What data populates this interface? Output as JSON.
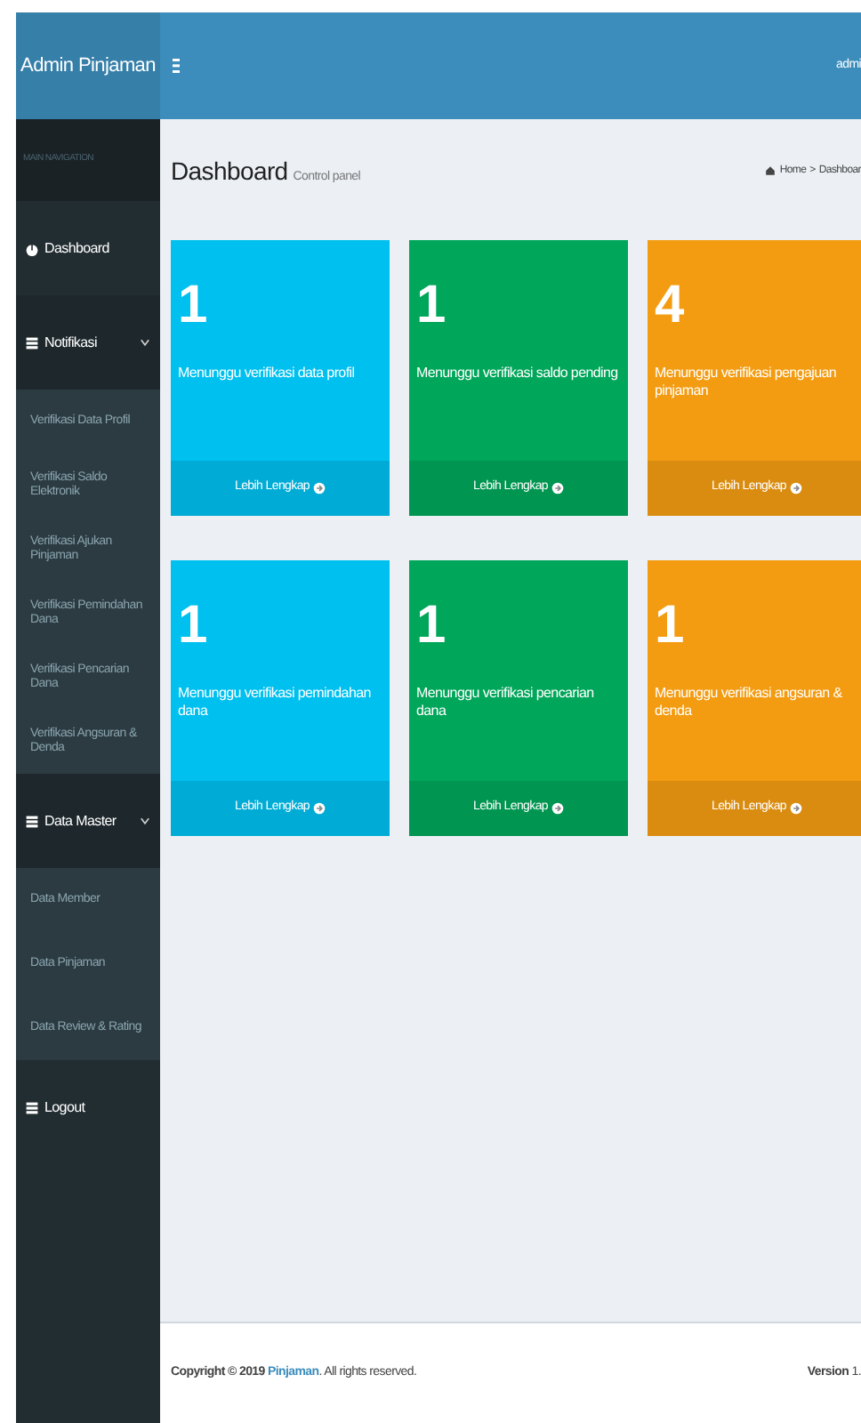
{
  "brand": "Admin Pinjaman",
  "header": {
    "user": "admi"
  },
  "sidebar": {
    "heading": "MAIN NAVIGATION",
    "items": [
      {
        "label": "Dashboard",
        "kind": "dashboard"
      },
      {
        "label": "Notifikasi",
        "kind": "menu",
        "expanded": true,
        "children": [
          {
            "label": "Verifikasi Data Profil"
          },
          {
            "label": "Verifikasi Saldo Elektronik"
          },
          {
            "label": "Verifikasi Ajukan Pinjaman"
          },
          {
            "label": "Verifikasi Pemindahan Dana"
          },
          {
            "label": "Verifikasi Pencarian Dana"
          },
          {
            "label": "Verifikasi Angsuran & Denda"
          }
        ]
      },
      {
        "label": "Data Master",
        "kind": "menu",
        "expanded": true,
        "children": [
          {
            "label": "Data Member"
          },
          {
            "label": "Data Pinjaman"
          },
          {
            "label": "Data Review & Rating"
          }
        ]
      },
      {
        "label": "Logout",
        "kind": "link"
      }
    ]
  },
  "page": {
    "title": "Dashboard",
    "subtitle": "Control panel",
    "breadcrumb": {
      "separator": ">",
      "items": [
        "Home",
        "Dashboar"
      ]
    }
  },
  "boxes": [
    {
      "count": "1",
      "text": "Menunggu verifikasi data profil",
      "link": "Lebih Lengkap",
      "color": "#00c0ef"
    },
    {
      "count": "1",
      "text": "Menunggu verifikasi saldo pending",
      "link": "Lebih Lengkap",
      "color": "#00a65a"
    },
    {
      "count": "4",
      "text": "Menunggu verifikasi pengajuan pinjaman",
      "link": "Lebih Lengkap",
      "color": "#f39c12"
    },
    {
      "count": "1",
      "text": "Menunggu verifikasi pemindahan dana",
      "link": "Lebih Lengkap",
      "color": "#00c0ef"
    },
    {
      "count": "1",
      "text": "Menunggu verifikasi pencarian dana",
      "link": "Lebih Lengkap",
      "color": "#00a65a"
    },
    {
      "count": "1",
      "text": "Menunggu verifikasi angsuran & denda",
      "link": "Lebih Lengkap",
      "color": "#f39c12"
    }
  ],
  "footer": {
    "copyright": "**Copyright © 2019** ",
    "link": "Pinjaman",
    "rest": ". All rights reserved.",
    "version": "**Version** 1."
  }
}
